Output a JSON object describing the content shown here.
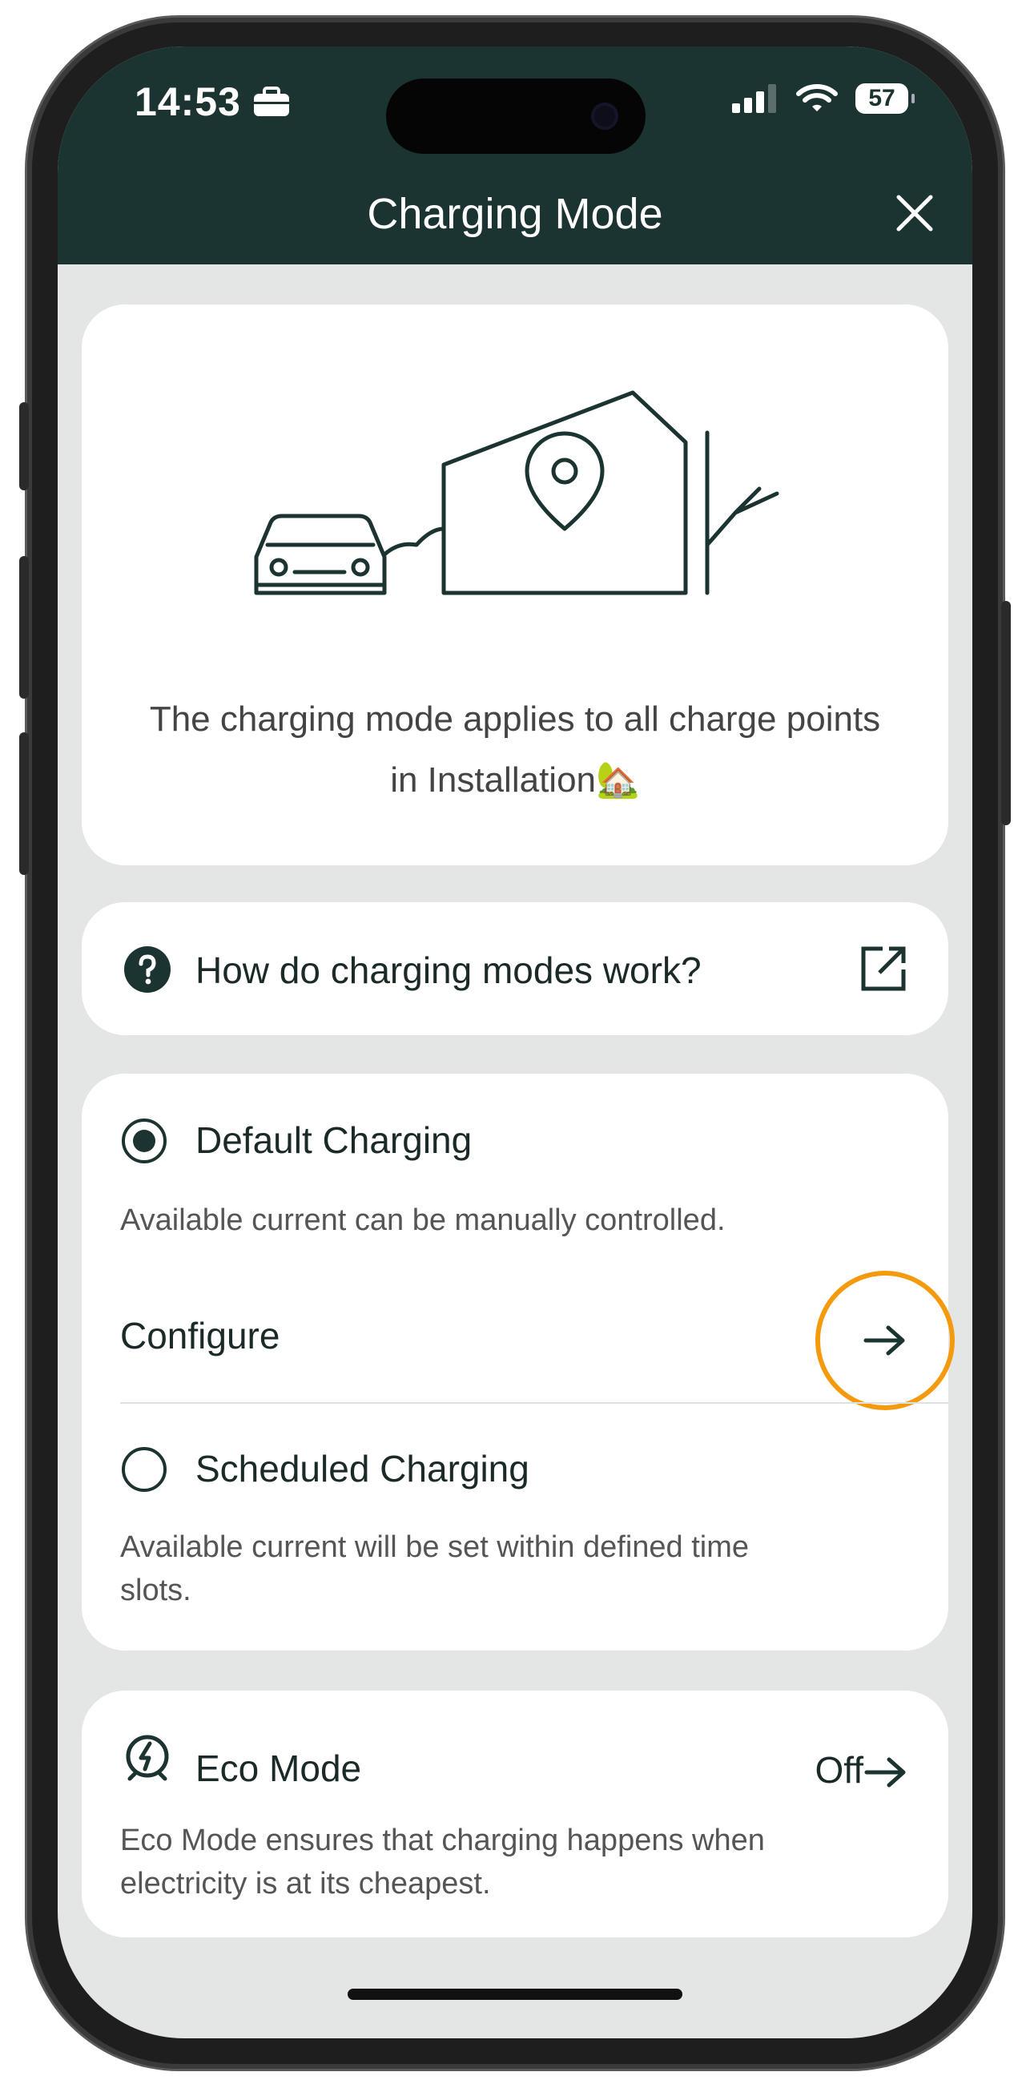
{
  "status_bar": {
    "time": "14:53",
    "battery": "57"
  },
  "header": {
    "title": "Charging Mode"
  },
  "intro": {
    "text": "The charging mode applies to all charge points in Installation🏡"
  },
  "help": {
    "label": "How do charging modes work?"
  },
  "modes": {
    "default": {
      "label": "Default Charging",
      "description": "Available current can be manually controlled.",
      "selected": true
    },
    "configure_label": "Configure",
    "scheduled": {
      "label": "Scheduled Charging",
      "description": "Available current will be set within defined time slots.",
      "selected": false
    }
  },
  "eco": {
    "label": "Eco Mode",
    "value": "Off",
    "description": "Eco Mode ensures that charging happens when electricity is at its cheapest."
  },
  "colors": {
    "header_bg": "#1b3431",
    "accent_highlight": "#f59a0c",
    "screen_bg": "#e3e6e5"
  }
}
